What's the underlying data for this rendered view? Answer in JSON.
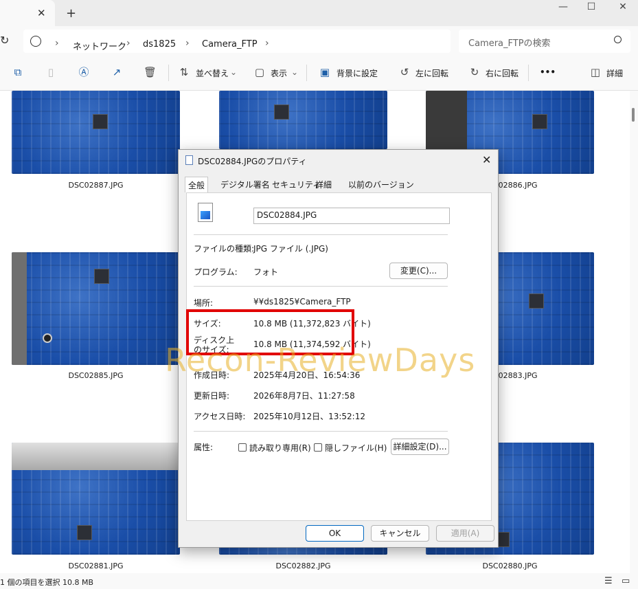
{
  "window": {
    "tab_close": "✕",
    "new_tab": "+",
    "minimize": "—",
    "maximize": "☐",
    "close": "✕"
  },
  "address": {
    "refresh": "↻",
    "breadcrumbs": [
      "ネットワーク",
      "ds1825",
      "Camera_FTP"
    ],
    "search_placeholder": "Camera_FTPの検索"
  },
  "toolbar": {
    "sort": "並べ替え",
    "view": "表示",
    "set_background": "背景に設定",
    "rotate_left": "左に回転",
    "rotate_right": "右に回転",
    "more": "•••",
    "details": "詳細"
  },
  "files": [
    {
      "name": "DSC02887.JPG"
    },
    {
      "name": "DSC02886.JPG"
    },
    {
      "name": "DSC02885.JPG"
    },
    {
      "name": "DSC02883.JPG"
    },
    {
      "name": "DSC02881.JPG"
    },
    {
      "name": "DSC02882.JPG"
    },
    {
      "name": "DSC02880.JPG"
    }
  ],
  "status": {
    "selection": "1 個の項目を選択  10.8 MB"
  },
  "dialog": {
    "title": "DSC02884.JPGのプロパティ",
    "tabs": [
      "全般",
      "デジタル署名",
      "セキュリティ",
      "詳細",
      "以前のバージョン"
    ],
    "filename": "DSC02884.JPG",
    "type_label": "ファイルの種類:",
    "type_value": "JPG ファイル (.JPG)",
    "program_label": "プログラム:",
    "program_value": "フォト",
    "change_button": "変更(C)...",
    "location_label": "場所:",
    "location_value": "¥¥ds1825¥Camera_FTP",
    "size_label": "サイズ:",
    "size_value": "10.8 MB (11,372,823 バイト)",
    "disk_size_label_1": "ディスク上",
    "disk_size_label_2": "のサイズ:",
    "disk_size_value": "10.8 MB (11,374,592 バイト)",
    "created_label": "作成日時:",
    "created_value": "2025年4月20日、16:54:36",
    "modified_label": "更新日時:",
    "modified_value": "2026年8月7日、11:27:58",
    "accessed_label": "アクセス日時:",
    "accessed_value": "2025年10月12日、13:52:12",
    "attributes_label": "属性:",
    "readonly_label": "読み取り専用(R)",
    "hidden_label": "隠しファイル(H)",
    "advanced_button": "詳細設定(D)...",
    "ok": "OK",
    "cancel": "キャンセル",
    "apply": "適用(A)"
  },
  "watermark": "Recon-ReviewDays",
  "colors": {
    "highlight": "#e10000",
    "watermark": "#e8b028",
    "accent": "#0067c0"
  }
}
